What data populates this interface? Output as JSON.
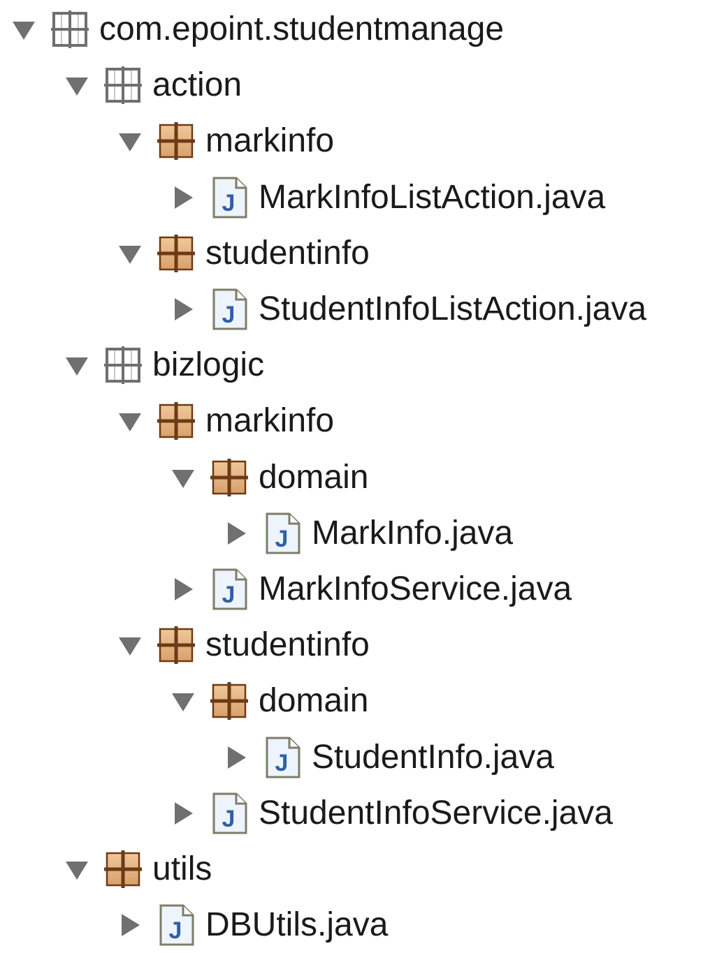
{
  "tree": {
    "items": [
      {
        "label": "com.epoint.studentmanage",
        "kind": "package-empty",
        "depth": 0,
        "expanded": true
      },
      {
        "label": "action",
        "kind": "package-empty",
        "depth": 1,
        "expanded": true
      },
      {
        "label": "markinfo",
        "kind": "package",
        "depth": 2,
        "expanded": true
      },
      {
        "label": "MarkInfoListAction.java",
        "kind": "java-file",
        "depth": 3,
        "expanded": false
      },
      {
        "label": "studentinfo",
        "kind": "package",
        "depth": 2,
        "expanded": true
      },
      {
        "label": "StudentInfoListAction.java",
        "kind": "java-file",
        "depth": 3,
        "expanded": false
      },
      {
        "label": "bizlogic",
        "kind": "package-empty",
        "depth": 1,
        "expanded": true
      },
      {
        "label": "markinfo",
        "kind": "package",
        "depth": 2,
        "expanded": true
      },
      {
        "label": "domain",
        "kind": "package",
        "depth": 3,
        "expanded": true
      },
      {
        "label": "MarkInfo.java",
        "kind": "java-file",
        "depth": 4,
        "expanded": false
      },
      {
        "label": "MarkInfoService.java",
        "kind": "java-file",
        "depth": 3,
        "expanded": false
      },
      {
        "label": "studentinfo",
        "kind": "package",
        "depth": 2,
        "expanded": true
      },
      {
        "label": "domain",
        "kind": "package",
        "depth": 3,
        "expanded": true
      },
      {
        "label": "StudentInfo.java",
        "kind": "java-file",
        "depth": 4,
        "expanded": false
      },
      {
        "label": "StudentInfoService.java",
        "kind": "java-file",
        "depth": 3,
        "expanded": false
      },
      {
        "label": "utils",
        "kind": "package",
        "depth": 1,
        "expanded": true
      },
      {
        "label": "DBUtils.java",
        "kind": "java-file",
        "depth": 2,
        "expanded": false
      }
    ]
  },
  "colors": {
    "twisty": "#707070",
    "package_fill": "#d9a06a",
    "package_line": "#6b3a16",
    "package_empty_line": "#6f6f6f",
    "file_paper": "#eef4fb",
    "file_border": "#7d7d6a",
    "java_letter": "#2f5fa8"
  },
  "icons": {
    "expanded": "triangle-down-icon",
    "collapsed": "triangle-right-icon",
    "package-empty": "empty-package-icon",
    "package": "package-icon",
    "java-file": "java-file-icon"
  }
}
